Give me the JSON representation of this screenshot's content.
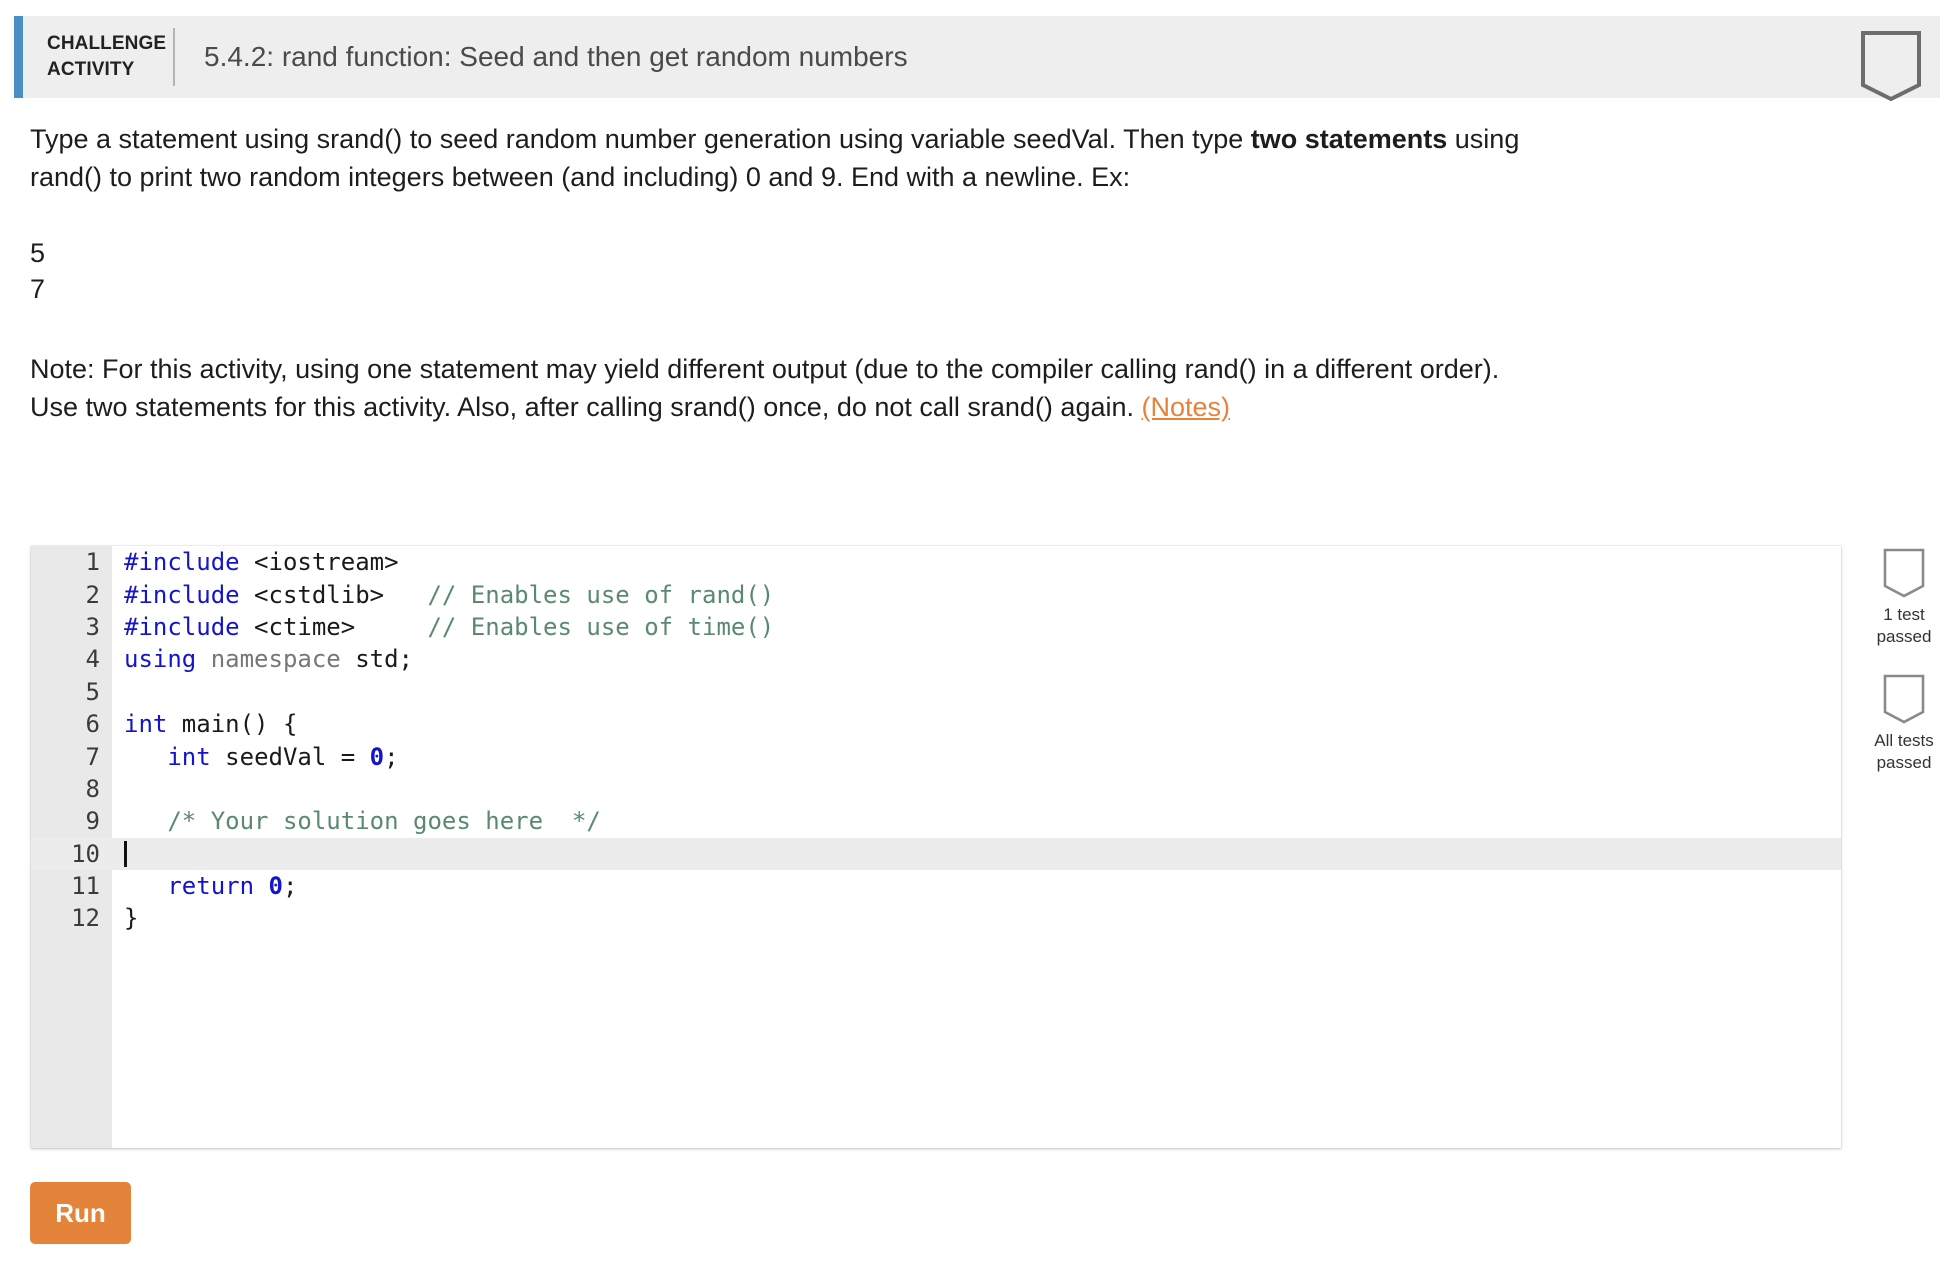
{
  "header": {
    "badge_line1": "CHALLENGE",
    "badge_line2": "ACTIVITY",
    "title": "5.4.2: rand function: Seed and then get random numbers",
    "accent_color": "#4a90c6",
    "background_color": "#eeeeee",
    "flag_icon": "pennant-icon"
  },
  "prompt": {
    "paragraph1_part1": "Type a statement using srand() to seed random number generation using variable seedVal. Then type ",
    "paragraph1_bold": "two statements",
    "paragraph1_part2": " using rand() to print two random integers between (and including) 0 and 9. End with a newline. Ex:",
    "example_lines": [
      "5",
      "7"
    ],
    "note_text": "Note: For this activity, using one statement may yield different output (due to the compiler calling rand() in a different order). Use two statements for this activity. Also, after calling srand() once, do not call srand() again. ",
    "notes_link": "(Notes)",
    "notes_link_color": "#e8823b"
  },
  "editor": {
    "language": "cpp",
    "active_line": 10,
    "cursor_line": 10,
    "gutter_color": "#e9e9e9",
    "active_line_color": "#ececec",
    "lines": [
      {
        "n": "1",
        "tokens": [
          {
            "t": "#include",
            "c": "pre"
          },
          {
            "t": " ",
            "c": "plain"
          },
          {
            "t": "<iostream>",
            "c": "plain"
          }
        ]
      },
      {
        "n": "2",
        "tokens": [
          {
            "t": "#include",
            "c": "pre"
          },
          {
            "t": " ",
            "c": "plain"
          },
          {
            "t": "<cstdlib>",
            "c": "plain"
          },
          {
            "t": "   ",
            "c": "plain"
          },
          {
            "t": "// Enables use of rand()",
            "c": "com"
          }
        ]
      },
      {
        "n": "3",
        "tokens": [
          {
            "t": "#include",
            "c": "pre"
          },
          {
            "t": " ",
            "c": "plain"
          },
          {
            "t": "<ctime>",
            "c": "plain"
          },
          {
            "t": "     ",
            "c": "plain"
          },
          {
            "t": "// Enables use of time()",
            "c": "com"
          }
        ]
      },
      {
        "n": "4",
        "tokens": [
          {
            "t": "using",
            "c": "kw"
          },
          {
            "t": " ",
            "c": "plain"
          },
          {
            "t": "namespace",
            "c": "ns"
          },
          {
            "t": " std;",
            "c": "plain"
          }
        ]
      },
      {
        "n": "5",
        "tokens": []
      },
      {
        "n": "6",
        "tokens": [
          {
            "t": "int",
            "c": "type"
          },
          {
            "t": " main() {",
            "c": "plain"
          }
        ]
      },
      {
        "n": "7",
        "tokens": [
          {
            "t": "   ",
            "c": "plain"
          },
          {
            "t": "int",
            "c": "type"
          },
          {
            "t": " seedVal ",
            "c": "plain"
          },
          {
            "t": "=",
            "c": "plain"
          },
          {
            "t": " ",
            "c": "plain"
          },
          {
            "t": "0",
            "c": "num"
          },
          {
            "t": ";",
            "c": "plain"
          }
        ]
      },
      {
        "n": "8",
        "tokens": []
      },
      {
        "n": "9",
        "tokens": [
          {
            "t": "   ",
            "c": "plain"
          },
          {
            "t": "/* Your solution goes here  */",
            "c": "com"
          }
        ]
      },
      {
        "n": "10",
        "tokens": [],
        "caret": true
      },
      {
        "n": "11",
        "tokens": [
          {
            "t": "   ",
            "c": "plain"
          },
          {
            "t": "return",
            "c": "kw"
          },
          {
            "t": " ",
            "c": "plain"
          },
          {
            "t": "0",
            "c": "num"
          },
          {
            "t": ";",
            "c": "plain"
          }
        ]
      },
      {
        "n": "12",
        "tokens": [
          {
            "t": "}",
            "c": "plain"
          }
        ]
      }
    ]
  },
  "test_sidebar": {
    "items": [
      {
        "icon": "pennant-icon",
        "label": "1 test\npassed"
      },
      {
        "icon": "pennant-icon",
        "label": "All tests\npassed"
      }
    ]
  },
  "run_button": {
    "label": "Run",
    "color": "#e4843a"
  }
}
